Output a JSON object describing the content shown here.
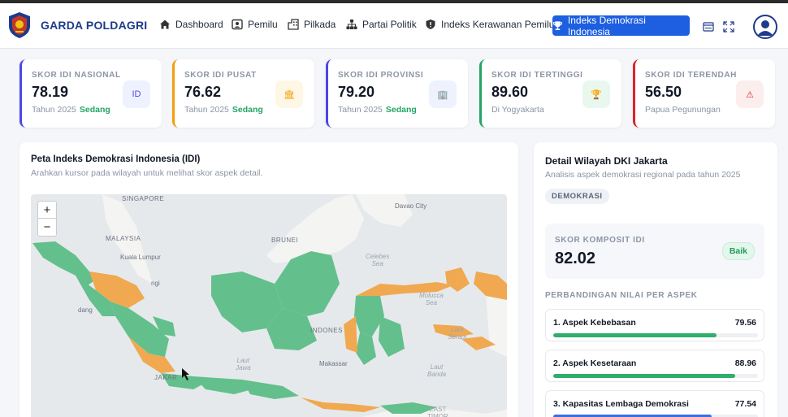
{
  "nav": {
    "brand": "GARDA POLDAGRI",
    "items": [
      {
        "label": "Dashboard",
        "icon": "home-icon"
      },
      {
        "label": "Pemilu",
        "icon": "id-card-icon"
      },
      {
        "label": "Pilkada",
        "icon": "building-icon"
      },
      {
        "label": "Partai Politik",
        "icon": "org-chart-icon"
      },
      {
        "label": "Indeks Kerawanan Pemilu",
        "icon": "shield-icon"
      }
    ],
    "active": {
      "label": "Indeks Demokrasi Indonesia",
      "icon": "trophy-icon"
    }
  },
  "cards": [
    {
      "label": "SKOR IDI NASIONAL",
      "value": "78.19",
      "sub": "Tahun 2025",
      "status": "Sedang",
      "icon_text": "ID",
      "accent": "#4f46e5",
      "icon_bg": "#eef2ff"
    },
    {
      "label": "SKOR IDI PUSAT",
      "value": "76.62",
      "sub": "Tahun 2025",
      "status": "Sedang",
      "icon_text": "🏛",
      "accent": "#f59e0b",
      "icon_bg": "#fff7e6"
    },
    {
      "label": "SKOR IDI PROVINSI",
      "value": "79.20",
      "sub": "Tahun 2025",
      "status": "Sedang",
      "icon_text": "🏢",
      "accent": "#4f46e5",
      "icon_bg": "#eef2ff"
    },
    {
      "label": "SKOR IDI TERTINGGI",
      "value": "89.60",
      "sub": "Di Yogyakarta",
      "status": "",
      "icon_text": "🏆",
      "accent": "#22a565",
      "icon_bg": "#e9f8ef"
    },
    {
      "label": "SKOR IDI TERENDAH",
      "value": "56.50",
      "sub": "Papua Pegunungan",
      "status": "",
      "icon_text": "⚠",
      "accent": "#dc2626",
      "icon_bg": "#fdeeee"
    }
  ],
  "map": {
    "title": "Peta Indeks Demokrasi Indonesia (IDI)",
    "description": "Arahkan kursor pada wilayah untuk melihat skor aspek detail.",
    "zoom_in": "+",
    "zoom_out": "−",
    "labels": {
      "malaysia": "MALAYSIA",
      "kuala_lumpur": "Kuala Lumpur",
      "brunei": "BRUNEI",
      "davao": "Davao City",
      "celebes": "Celebes\nSea",
      "molucca": "Molucca\nSea",
      "laut_jawa": "Laut\nJawa",
      "laut_banda": "Laut\nBanda",
      "laut_seram": "Laut\nSeram",
      "indonesia": "INDONES",
      "makassar": "Makassar",
      "jakarta": "JAKAR",
      "timor": "EAST\nTIMOR",
      "singapore": "SINGAPORE",
      "lampung": "ngi",
      "padang": "dang"
    },
    "colors": {
      "green": "#63c08c",
      "orange": "#f0a950",
      "land_other": "#f4f4f2",
      "water": "#e6e9ec"
    }
  },
  "detail": {
    "title": "Detail Wilayah DKI Jakarta",
    "subtitle": "Analisis aspek demokrasi regional pada tahun 2025",
    "badge": "DEMOKRASI",
    "composite_label": "SKOR KOMPOSIT IDI",
    "composite_value": "82.02",
    "composite_badge": "Baik",
    "comparison_label": "PERBANDINGAN NILAI PER ASPEK",
    "aspects": [
      {
        "name": "1. Aspek Kebebasan",
        "value": "79.56",
        "fraction": 0.7956,
        "color": "#2fae6e"
      },
      {
        "name": "2. Aspek Kesetaraan",
        "value": "88.96",
        "fraction": 0.8896,
        "color": "#2fae6e"
      },
      {
        "name": "3. Kapasitas Lembaga Demokrasi",
        "value": "77.54",
        "fraction": 0.7754,
        "color": "#3b6fe0"
      }
    ]
  }
}
